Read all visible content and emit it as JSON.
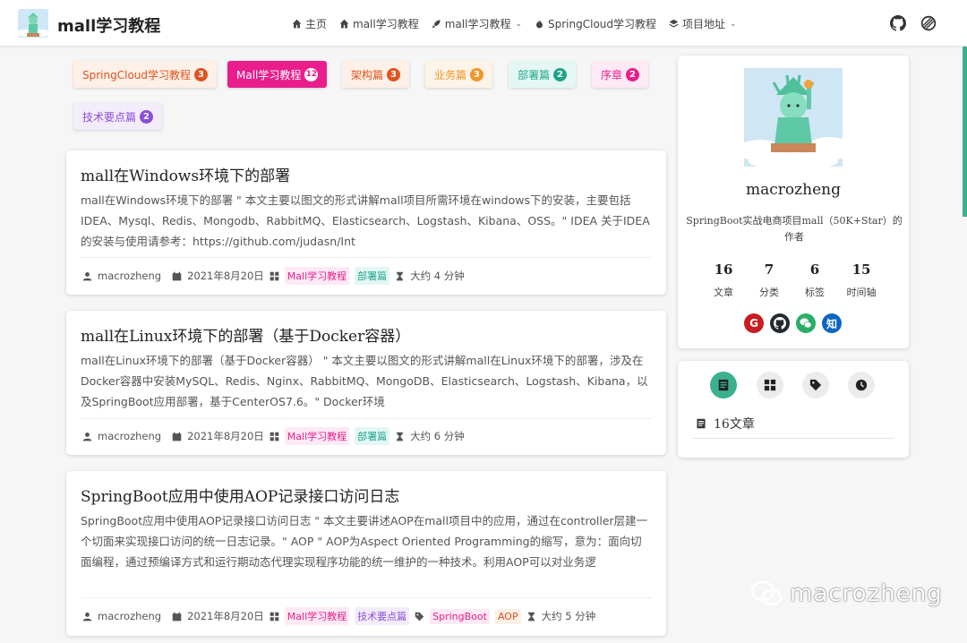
{
  "header": {
    "site_title": "mall学习教程",
    "nav": [
      {
        "label": "主页",
        "icon": "home-icon",
        "has_dropdown": false
      },
      {
        "label": "mall学习教程",
        "icon": "home-icon",
        "has_dropdown": false
      },
      {
        "label": "mall学习教程",
        "icon": "rocket-icon",
        "has_dropdown": true
      },
      {
        "label": "SpringCloud学习教程",
        "icon": "fire-icon",
        "has_dropdown": false
      },
      {
        "label": "项目地址",
        "icon": "layers-icon",
        "has_dropdown": true
      }
    ]
  },
  "categories": [
    {
      "label": "SpringCloud学习教程",
      "count": "3",
      "bg": "#fdf0e7",
      "fg": "#e0531f",
      "badge": "#e0531f"
    },
    {
      "label": "Mall学习教程",
      "count": "12",
      "bg": "#e91e8c",
      "fg": "#ffffff",
      "badge": "#ffffff"
    },
    {
      "label": "架构篇",
      "count": "3",
      "bg": "#fdf0e7",
      "fg": "#e0531f",
      "badge": "#e0531f"
    },
    {
      "label": "业务篇",
      "count": "3",
      "bg": "#fdf3e6",
      "fg": "#f0962a",
      "badge": "#f0962a"
    },
    {
      "label": "部署篇",
      "count": "2",
      "bg": "#e5f7f4",
      "fg": "#1ea58a",
      "badge": "#1ea58a"
    },
    {
      "label": "序章",
      "count": "2",
      "bg": "#fdeaf4",
      "fg": "#e91e8c",
      "badge": "#e91e8c"
    },
    {
      "label": "技术要点篇",
      "count": "2",
      "bg": "#f3ecfb",
      "fg": "#8a4fd6",
      "badge": "#8a4fd6"
    }
  ],
  "posts": [
    {
      "title": "mall在Windows环境下的部署",
      "excerpt": "mall在Windows环境下的部署 \" 本文主要以图文的形式讲解mall项目所需环境在windows下的安装，主要包括IDEA、Mysql、Redis、Mongodb、RabbitMQ、Elasticsearch、Logstash、Kibana、OSS。\" IDEA 关于IDEA的安装与使用请参考：https://github.com/judasn/Int",
      "author": "macrozheng",
      "date": "2021年8月20日",
      "tags": [
        "Mall学习教程",
        "部署篇"
      ],
      "read_time": "大约 4 分钟"
    },
    {
      "title": "mall在Linux环境下的部署（基于Docker容器）",
      "excerpt": "mall在Linux环境下的部署（基于Docker容器） \" 本文主要以图文的形式讲解mall在Linux环境下的部署，涉及在Docker容器中安装MySQL、Redis、Nginx、RabbitMQ、MongoDB、Elasticsearch、Logstash、Kibana，以及SpringBoot应用部署，基于CenterOS7.6。\" Docker环境",
      "author": "macrozheng",
      "date": "2021年8月20日",
      "tags": [
        "Mall学习教程",
        "部署篇"
      ],
      "read_time": "大约 6 分钟"
    },
    {
      "title": "SpringBoot应用中使用AOP记录接口访问日志",
      "excerpt": "SpringBoot应用中使用AOP记录接口访问日志 \" 本文主要讲述AOP在mall项目中的应用，通过在controller层建一个切面来实现接口访问的统一日志记录。\" AOP \" AOP为Aspect Oriented Programming的缩写，意为：面向切面编程，通过预编译方式和运行期动态代理实现程序功能的统一维护的一种技术。利用AOP可以对业务逻",
      "author": "macrozheng",
      "date": "2021年8月20日",
      "tags": [
        "Mall学习教程",
        "技术要点篇"
      ],
      "extra_tags": [
        "SpringBoot",
        "AOP"
      ],
      "read_time": "大约 5 分钟"
    }
  ],
  "profile": {
    "name": "macrozheng",
    "bio": "SpringBoot实战电商项目mall（50K+Star）的作者",
    "stats": [
      {
        "num": "16",
        "label": "文章"
      },
      {
        "num": "7",
        "label": "分类"
      },
      {
        "num": "6",
        "label": "标签"
      },
      {
        "num": "15",
        "label": "时间轴"
      }
    ],
    "social": [
      {
        "icon": "gitee-icon",
        "glyph": "G",
        "color": "#c71d23"
      },
      {
        "icon": "github-icon",
        "glyph": "",
        "color": "#24292e"
      },
      {
        "icon": "wechat-icon",
        "glyph": "",
        "color": "#2aae67"
      },
      {
        "icon": "zhihu-icon",
        "glyph": "知",
        "color": "#0a66c2"
      }
    ]
  },
  "sidebar_tabs": {
    "article_count": "16文章"
  },
  "watermark": "macrozheng"
}
